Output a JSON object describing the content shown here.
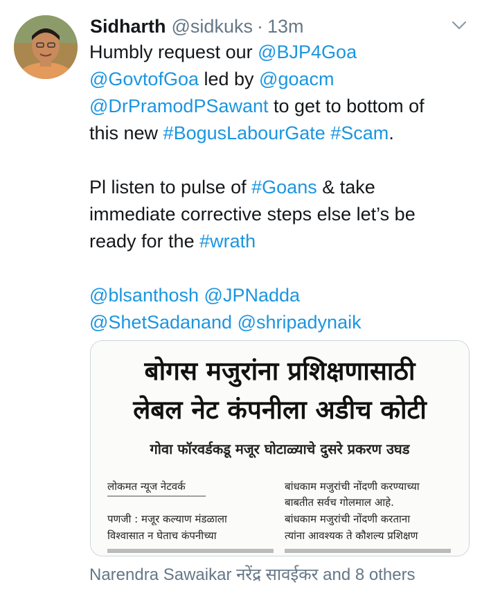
{
  "tweet": {
    "author_name": "Sidharth",
    "author_handle": "@sidkuks",
    "separator": "·",
    "time": "13m",
    "body": [
      {
        "t": "Humbly request our "
      },
      {
        "t": "@BJP4Goa",
        "link": true
      },
      {
        "t": "\n"
      },
      {
        "t": "@GovtofGoa",
        "link": true
      },
      {
        "t": " led by "
      },
      {
        "t": "@goacm",
        "link": true
      },
      {
        "t": "\n"
      },
      {
        "t": "@DrPramodPSawant",
        "link": true
      },
      {
        "t": " to get to bottom of\nthis new "
      },
      {
        "t": "#BogusLabourGate",
        "link": true
      },
      {
        "t": " "
      },
      {
        "t": "#Scam",
        "link": true
      },
      {
        "t": ".\n\nPl listen to pulse of "
      },
      {
        "t": "#Goans",
        "link": true
      },
      {
        "t": " & take\nimmediate corrective steps else let’s be\nready for the "
      },
      {
        "t": "#wrath",
        "link": true
      },
      {
        "t": "\n\n"
      },
      {
        "t": "@blsanthosh",
        "link": true
      },
      {
        "t": " "
      },
      {
        "t": "@JPNadda",
        "link": true
      },
      {
        "t": "\n"
      },
      {
        "t": "@ShetSadanand",
        "link": true
      },
      {
        "t": " "
      },
      {
        "t": "@shripadynaik",
        "link": true
      }
    ]
  },
  "newspaper": {
    "headline_1": "बोगस मजुरांना प्रशिक्षणासाठी",
    "headline_2": "लेबल नेट कंपनीला अडीच कोटी",
    "subhead": "गोवा फॉरवर्डकडू मजूर घोटाळ्याचे दुसरे प्रकरण उघड",
    "byline": "लोकमत न्यूज नेटवर्क",
    "col_right_line_1": "बांधकाम मजुरांची नोंदणी करण्याच्या",
    "col_right_line_2": "बाबतीत सर्वच गोलमाल आहे.",
    "col_left_line_1": "पणजी : मजूर कल्याण मंडळाला",
    "col_right_line_3": "बांधकाम मजुरांची नोंदणी करताना",
    "col_left_line_2": "विश्वासात न घेताच कंपनीच्या",
    "col_right_line_4": "त्यांना आवश्यक ते कौशल्य प्रशिक्षण"
  },
  "footer": {
    "liked_by": "Narendra Sawaikar नरेंद्र सावईकर and 8 others"
  },
  "colors": {
    "link": "#1b95e0",
    "muted": "#657786",
    "text": "#14171a"
  },
  "icons": {
    "more": "chevron-down-icon"
  }
}
